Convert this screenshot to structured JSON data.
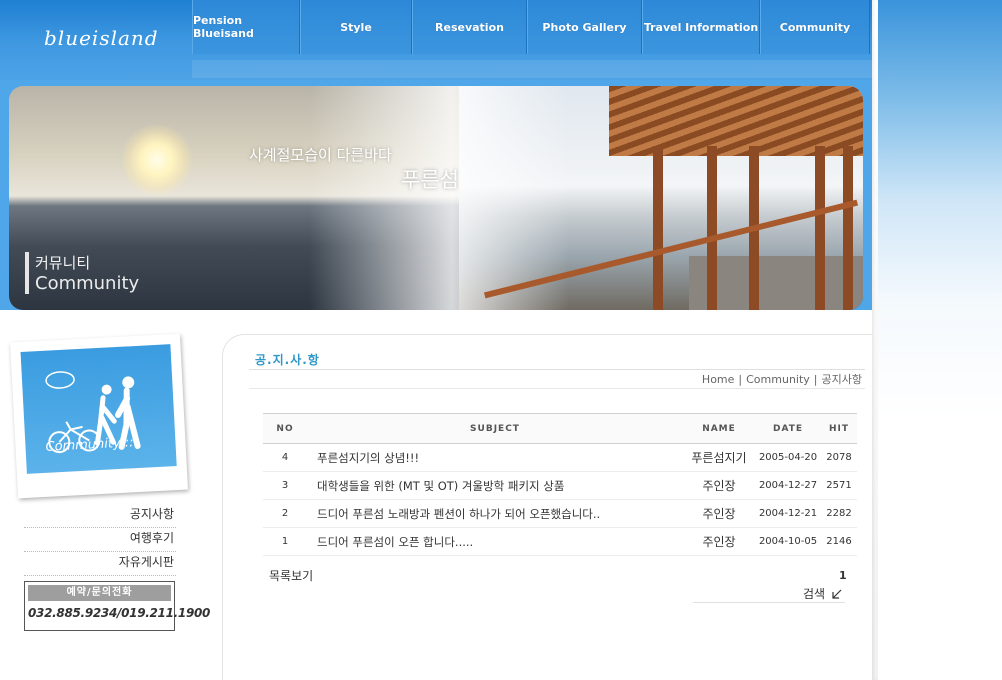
{
  "site": {
    "logo": "blueisland"
  },
  "nav": [
    {
      "label": "Pension Blueisand",
      "width": 108
    },
    {
      "label": "Style",
      "width": 112
    },
    {
      "label": "Resevation",
      "width": 115
    },
    {
      "label": "Photo Gallery",
      "width": 115
    },
    {
      "label": "Travel Information",
      "width": 118
    },
    {
      "label": "Community",
      "width": 110
    }
  ],
  "banner": {
    "title_line1": "사계절모습이 다른바다",
    "title_line2": "푸른섬",
    "section_kr": "커뮤니티",
    "section_en": "Community"
  },
  "sidebar": {
    "photo_caption": "Community ::",
    "menu": [
      "공지사항",
      "여행후기",
      "자유게시판"
    ],
    "phone_title": "예약/문의전화",
    "phone_number": "032.885.9234/019.211.1900"
  },
  "content": {
    "page_title": "공.지.사.항",
    "breadcrumb": [
      "Home",
      "Community",
      "공지사항"
    ],
    "board": {
      "columns": [
        "NO",
        "SUBJECT",
        "NAME",
        "DATE",
        "HIT"
      ],
      "rows": [
        {
          "no": "4",
          "subject": "푸른섬지기의 상념!!!",
          "name": "푸른섬지기",
          "date": "2005-04-20",
          "hit": "2078"
        },
        {
          "no": "3",
          "subject": "대학생들을 위한 (MT 및 OT) 겨울방학 패키지 상품",
          "name": "주인장",
          "date": "2004-12-27",
          "hit": "2571"
        },
        {
          "no": "2",
          "subject": "드디어 푸른섬 노래방과 펜션이 하나가 되어 오픈했습니다..",
          "name": "주인장",
          "date": "2004-12-21",
          "hit": "2282"
        },
        {
          "no": "1",
          "subject": "드디어 푸른섬이 오픈 합니다.....",
          "name": "주인장",
          "date": "2004-10-05",
          "hit": "2146"
        }
      ]
    },
    "list_label": "목록보기",
    "page_number": "1",
    "search_label": "검색"
  }
}
